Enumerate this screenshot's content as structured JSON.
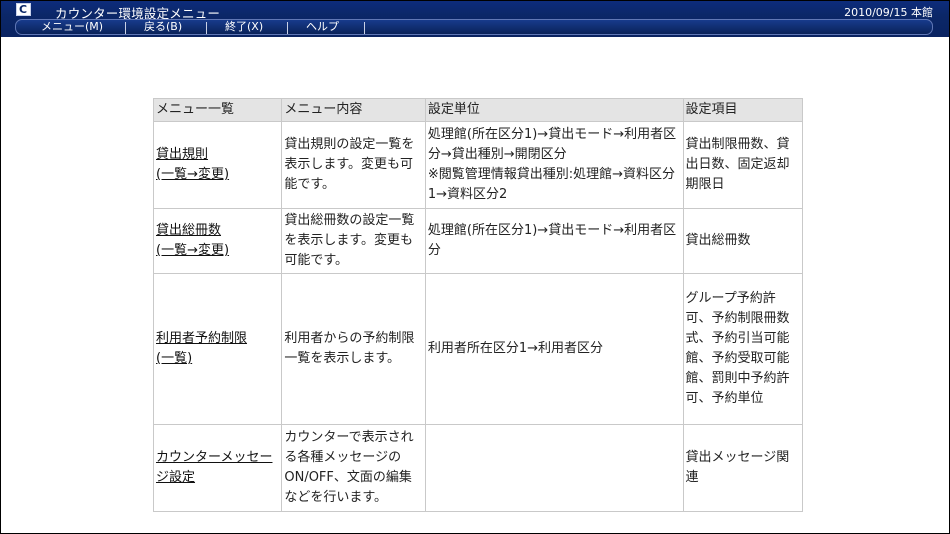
{
  "window": {
    "title": "カウンター環境設定メニュー",
    "date_location": "2010/09/15 本館",
    "icon": "app-c-icon"
  },
  "menubar": {
    "items": [
      {
        "label": "メニュー(M)"
      },
      {
        "label": "戻る(B)"
      },
      {
        "label": "終了(X)"
      },
      {
        "label": "ヘルプ"
      }
    ]
  },
  "table": {
    "headers": [
      "メニュー一覧",
      "メニュー内容",
      "設定単位",
      "設定項目"
    ],
    "rows": [
      {
        "menu_link": "貸出規則\n(一覧→変更)",
        "content": "貸出規則の設定一覧を表示します。変更も可能です。",
        "unit": "処理館(所在区分1)→貸出モード→利用者区分→貸出種別→開閉区分\n※閲覧管理情報貸出種別:処理館→資料区分1→資料区分2",
        "items": "貸出制限冊数、貸出日数、固定返却期限日"
      },
      {
        "menu_link": "貸出総冊数\n(一覧→変更)",
        "content": "貸出総冊数の設定一覧を表示します。変更も可能です。",
        "unit": "処理館(所在区分1)→貸出モード→利用者区分",
        "items": "貸出総冊数"
      },
      {
        "menu_link": "利用者予約制限\n(一覧)",
        "content": "利用者からの予約制限一覧を表示します。",
        "unit": "利用者所在区分1→利用者区分",
        "items": "グループ予約許可、予約制限冊数式、予約引当可能館、予約受取可能館、罰則中予約許可、予約単位"
      },
      {
        "menu_link": "カウンターメッセージ設定",
        "content": "カウンターで表示される各種メッセージのON/OFF、文面の編集などを行います。",
        "unit": "",
        "items": "貸出メッセージ関連"
      }
    ]
  },
  "colors": {
    "titlebar": "#0b2768",
    "header_bg": "#e4e4e4",
    "border": "#c9c9c9"
  }
}
